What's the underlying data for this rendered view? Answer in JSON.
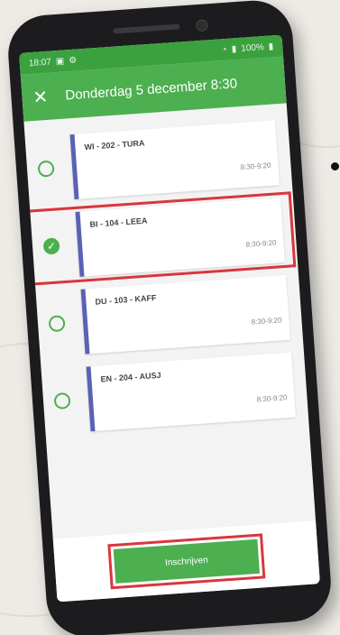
{
  "status_bar": {
    "time": "18:07",
    "battery": "100%"
  },
  "app_bar": {
    "close_icon": "close-icon",
    "title": "Donderdag 5 december 8:30"
  },
  "options": [
    {
      "title": "WI - 202 - TURA",
      "time": "8:30-9:20",
      "selected": false
    },
    {
      "title": "BI - 104 - LEEA",
      "time": "8:30-9:20",
      "selected": true
    },
    {
      "title": "DU - 103 - KAFF",
      "time": "8:30-9:20",
      "selected": false
    },
    {
      "title": "EN - 204 - AUSJ",
      "time": "8:30-9:20",
      "selected": false
    }
  ],
  "footer": {
    "submit_label": "Inschrijven"
  },
  "colors": {
    "primary": "#4caf50",
    "status_bar": "#3ba13f",
    "card_accent": "#5b62b4",
    "highlight": "#d9363e"
  }
}
